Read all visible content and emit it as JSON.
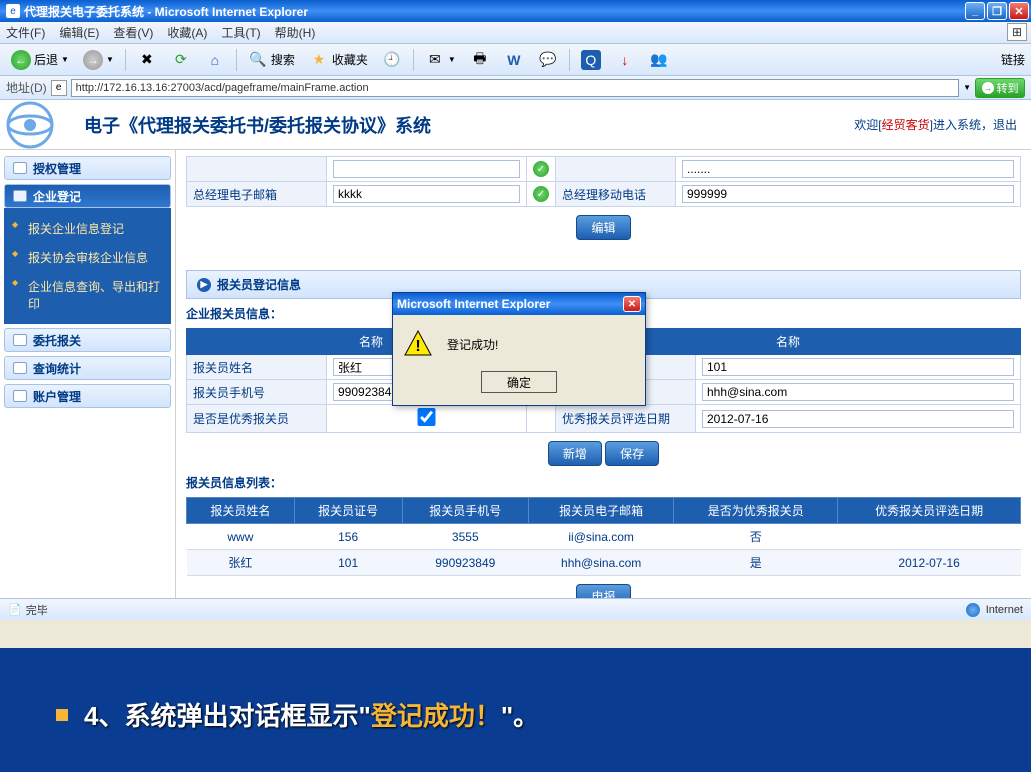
{
  "window": {
    "title": "代理报关电子委托系统 - Microsoft Internet Explorer",
    "min": "_",
    "max": "❐",
    "close": "✕"
  },
  "menus": [
    "文件(F)",
    "编辑(E)",
    "查看(V)",
    "收藏(A)",
    "工具(T)",
    "帮助(H)"
  ],
  "toolbar": {
    "back": "后退",
    "search": "搜索",
    "favorites": "收藏夹",
    "links": "链接"
  },
  "address": {
    "label": "地址(D)",
    "url": "http://172.16.13.16:27003/acd/pageframe/mainFrame.action",
    "go": "转到"
  },
  "app": {
    "title": "电子《代理报关委托书/委托报关协议》系统",
    "welcome_pre": "欢迎[",
    "welcome_user": "经贸客货",
    "welcome_post": "]进入系统，退出"
  },
  "sidebar": {
    "groups": [
      "授权管理",
      "企业登记",
      "委托报关",
      "查询统计",
      "账户管理"
    ],
    "subitems": [
      "报关企业信息登记",
      "报关协会审核企业信息",
      "企业信息查询、导出和打印"
    ]
  },
  "top_table": {
    "r1": {
      "l1": "",
      "v1": "",
      "l2": "",
      "v2": "......."
    },
    "r2": {
      "l1": "总经理电子邮箱",
      "v1": "kkkk",
      "l2": "总经理移动电话",
      "v2": "999999"
    },
    "btn": "编辑"
  },
  "panel_title": "报关员登记信息",
  "info_title": "企业报关员信息：",
  "info_header1": "名称",
  "info_header2": "名称",
  "info": {
    "r1": {
      "l1": "报关员姓名",
      "v1": "张红",
      "l2": "报关员证号",
      "v2": "101"
    },
    "r2": {
      "l1": "报关员手机号",
      "v1": "990923849",
      "l2": "报关员电子邮箱",
      "v2": "hhh@sina.com"
    },
    "r3": {
      "l1": "是否是优秀报关员",
      "l2": "优秀报关员评选日期",
      "v2": "2012-07-16"
    }
  },
  "btn_new": "新增",
  "btn_save": "保存",
  "list_title": "报关员信息列表：",
  "list_headers": [
    "报关员姓名",
    "报关员证号",
    "报关员手机号",
    "报关员电子邮箱",
    "是否为优秀报关员",
    "优秀报关员评选日期"
  ],
  "list_rows": [
    [
      "www",
      "156",
      "3555",
      "ii@sina.com",
      "否",
      ""
    ],
    [
      "张红",
      "101",
      "990923849",
      "hhh@sina.com",
      "是",
      "2012-07-16"
    ]
  ],
  "btn_apply": "申报",
  "status": {
    "left": "完毕",
    "right": "Internet"
  },
  "dialog": {
    "title": "Microsoft Internet Explorer",
    "msg": "登记成功!",
    "ok": "确定"
  },
  "caption": {
    "num": "4、",
    "pre": "系统弹出对话框显示",
    "q1": "\"",
    "hl": "登记成功！",
    "q2": "\"",
    "post": "。"
  }
}
